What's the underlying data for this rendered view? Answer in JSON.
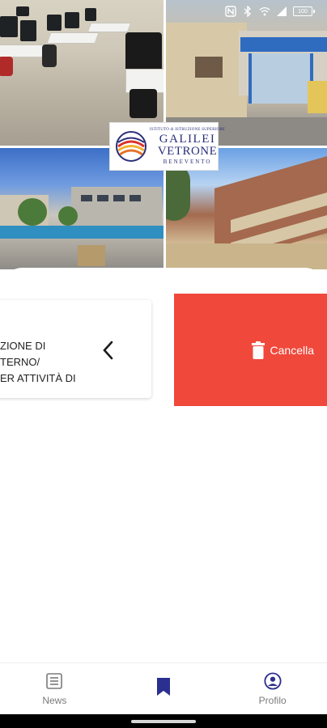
{
  "status_bar": {
    "battery_level": "100",
    "icons": [
      "nfc-icon",
      "bluetooth-icon",
      "wifi-icon",
      "signal-icon",
      "battery-icon"
    ]
  },
  "header": {
    "logo": {
      "top_line": "ISTITUTO di ISTRUZIONE SUPERIORE",
      "name_line_1": "GALILEI",
      "name_line_2": "VETRONE",
      "city": "BENEVENTO"
    }
  },
  "saved_item": {
    "title_lines": [
      "ZIONE DI",
      "TERNO/",
      "ER ATTIVITÀ DI"
    ],
    "swipe_action": {
      "label": "Cancella",
      "icon": "trash-icon",
      "color": "#f0483b"
    }
  },
  "bottom_nav": {
    "items": [
      {
        "label": "News",
        "icon": "news-icon",
        "active": false
      },
      {
        "label": "",
        "icon": "bookmark-icon",
        "active": true
      },
      {
        "label": "Profilo",
        "icon": "profile-icon",
        "active": false
      }
    ],
    "active_color": "#2b2f8f",
    "inactive_color": "#7a7a7a"
  }
}
